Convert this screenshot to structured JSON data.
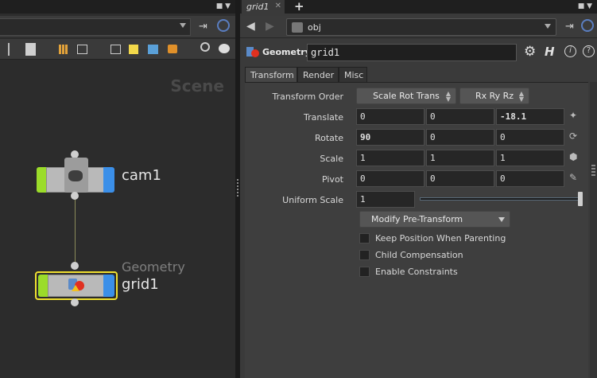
{
  "network": {
    "scene_label": "Scene",
    "nodes": [
      {
        "name": "cam1",
        "type_label": ""
      },
      {
        "name": "grid1",
        "type_label": "Geometry"
      }
    ]
  },
  "params_pane": {
    "tab_label": "grid1",
    "path": "obj",
    "node_type": "Geometry",
    "node_name": "grid1",
    "tabs": [
      "Transform",
      "Render",
      "Misc"
    ],
    "transform_order": {
      "label": "Transform Order",
      "value": "Scale Rot Trans",
      "rot_order": "Rx Ry Rz"
    },
    "translate": {
      "label": "Translate",
      "values": [
        "0",
        "0",
        "-18.1"
      ]
    },
    "rotate": {
      "label": "Rotate",
      "values": [
        "90",
        "0",
        "0"
      ]
    },
    "scale": {
      "label": "Scale",
      "values": [
        "1",
        "1",
        "1"
      ]
    },
    "pivot": {
      "label": "Pivot",
      "values": [
        "0",
        "0",
        "0"
      ]
    },
    "uniform_scale": {
      "label": "Uniform Scale",
      "value": "1",
      "slider_fraction": 1.0
    },
    "modify_menu": "Modify Pre-Transform",
    "checkboxes": [
      {
        "label": "Keep Position When Parenting",
        "checked": false
      },
      {
        "label": "Child Compensation",
        "checked": false
      },
      {
        "label": "Enable Constraints",
        "checked": false
      }
    ]
  },
  "colors": {
    "node_flag_left": "#9bdc2a",
    "node_flag_right": "#3b8fe8",
    "selection": "#f0e030"
  }
}
